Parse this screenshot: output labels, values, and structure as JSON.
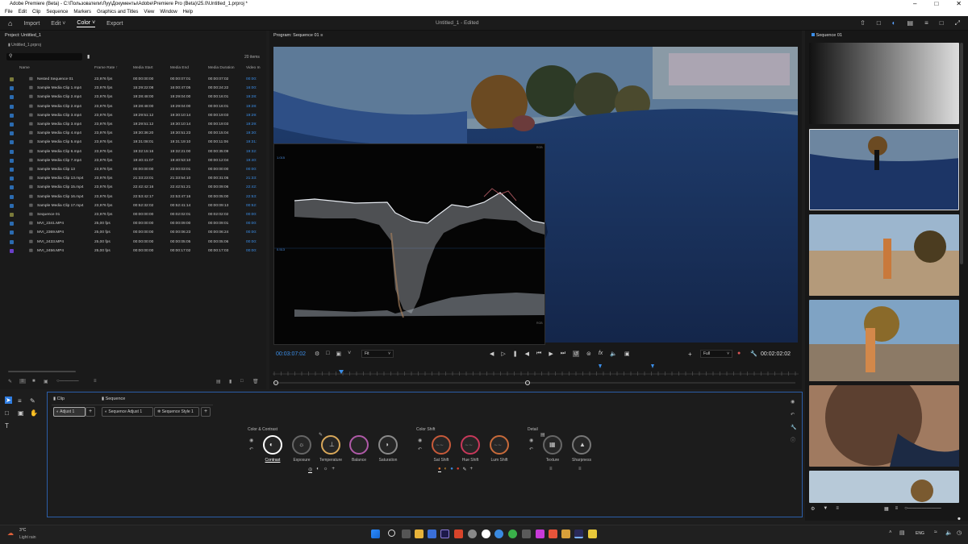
{
  "window": {
    "title": "Adobe Premiere (Beta) - C:\\Пользователи\\Луу\\Документы\\Adobe\\Premiere Pro (Beta)\\25.0\\Untitled_1.prproj *"
  },
  "menu": [
    "File",
    "Edit",
    "Clip",
    "Sequence",
    "Markers",
    "Graphics and Titles",
    "View",
    "Window",
    "Help"
  ],
  "header": {
    "nav": [
      "Import",
      "Edit",
      "Color",
      "Export"
    ],
    "active_nav": "Color",
    "document": "Untitled_1 - Edited"
  },
  "project": {
    "title": "Project: Untitled_1",
    "file": "Untitled_1.prproj",
    "items_count": "20 items",
    "columns": [
      "Name",
      "Frame Rate",
      "Media Start",
      "Media End",
      "Media Duration",
      "Video In"
    ],
    "rows": [
      {
        "name": "Nested Sequence 01",
        "fps": "23,976 fps",
        "start": "00:00:00:00",
        "end": "00:00:07:01",
        "dur": "00:00:07:02",
        "vin": "00:00:",
        "color": "#7a7a3a"
      },
      {
        "name": "Sample Media Clip 1.mp4",
        "fps": "23,976 fps",
        "start": "15:29:22:08",
        "end": "16:00:47:05",
        "dur": "00:00:24:22",
        "vin": "16:00:",
        "color": "#2b6bb0"
      },
      {
        "name": "Sample Media Clip 2.mp4",
        "fps": "23,976 fps",
        "start": "19:28:48:00",
        "end": "19:29:04:00",
        "dur": "00:00:16:01",
        "vin": "19:28:",
        "color": "#2b6bb0"
      },
      {
        "name": "Sample Media Clip 2.mp4",
        "fps": "23,976 fps",
        "start": "19:28:48:00",
        "end": "19:29:04:00",
        "dur": "00:00:16:01",
        "vin": "19:28:",
        "color": "#2b6bb0"
      },
      {
        "name": "Sample Media Clip 3.mp4",
        "fps": "23,976 fps",
        "start": "19:29:51:12",
        "end": "19:30:10:14",
        "dur": "00:00:19:03",
        "vin": "19:29:",
        "color": "#2b6bb0"
      },
      {
        "name": "Sample Media Clip 3.mp4",
        "fps": "23,976 fps",
        "start": "19:29:51:12",
        "end": "19:30:10:14",
        "dur": "00:00:19:03",
        "vin": "19:29:",
        "color": "#2b6bb0"
      },
      {
        "name": "Sample Media Clip 4.mp4",
        "fps": "23,976 fps",
        "start": "19:30:36:20",
        "end": "19:30:51:23",
        "dur": "00:00:15:04",
        "vin": "19:30:",
        "color": "#2b6bb0"
      },
      {
        "name": "Sample Media Clip 5.mp4",
        "fps": "23,976 fps",
        "start": "19:31:08:01",
        "end": "19:31:19:10",
        "dur": "00:00:11:06",
        "vin": "19:31:",
        "color": "#2b6bb0"
      },
      {
        "name": "Sample Media Clip 6.mp4",
        "fps": "23,976 fps",
        "start": "19:32:15:16",
        "end": "19:32:21:00",
        "dur": "00:00:35:09",
        "vin": "19:32:",
        "color": "#2b6bb0"
      },
      {
        "name": "Sample Media Clip 7.mp4",
        "fps": "23,976 fps",
        "start": "19:40:41:07",
        "end": "19:40:53:10",
        "dur": "00:00:12:04",
        "vin": "19:40:",
        "color": "#2b6bb0"
      },
      {
        "name": "Sample Media Clip 13",
        "fps": "23,976 fps",
        "start": "00:00:00:00",
        "end": "23:00:03:01",
        "dur": "00:00:00:00",
        "vin": "00:00:",
        "color": "#2b6bb0"
      },
      {
        "name": "Sample Media Clip 13.mp4",
        "fps": "23,976 fps",
        "start": "21:33:23:01",
        "end": "21:33:54:10",
        "dur": "00:00:31:05",
        "vin": "21:33:",
        "color": "#2b6bb0"
      },
      {
        "name": "Sample Media Clip 15.mp4",
        "fps": "23,976 fps",
        "start": "22:42:42:16",
        "end": "22:42:51:21",
        "dur": "00:00:09:06",
        "vin": "22:42:",
        "color": "#2b6bb0"
      },
      {
        "name": "Sample Media Clip 16.mp4",
        "fps": "23,976 fps",
        "start": "22:53:42:17",
        "end": "22:53:47:16",
        "dur": "00:00:05:00",
        "vin": "22:53:",
        "color": "#2b6bb0"
      },
      {
        "name": "Sample Media Clip 17.mp4",
        "fps": "23,976 fps",
        "start": "00:52:32:02",
        "end": "00:52:41:14",
        "dur": "00:00:09:13",
        "vin": "00:52:",
        "color": "#2b6bb0"
      },
      {
        "name": "Sequence 01",
        "fps": "23,976 fps",
        "start": "00:00:00:00",
        "end": "00:02:02:01",
        "dur": "00:02:02:02",
        "vin": "00:00:",
        "color": "#7a7a3a"
      },
      {
        "name": "MVI_2341.MP4",
        "fps": "25,00 fps",
        "start": "00:00:00:00",
        "end": "00:00:09:00",
        "dur": "00:00:09:01",
        "vin": "00:00:",
        "color": "#2b6bb0"
      },
      {
        "name": "MVI_2369.MP4",
        "fps": "25,00 fps",
        "start": "00:00:00:00",
        "end": "00:00:06:23",
        "dur": "00:00:06:24",
        "vin": "00:00:",
        "color": "#2b6bb0"
      },
      {
        "name": "MVI_2433.MP4",
        "fps": "25,00 fps",
        "start": "00:00:00:00",
        "end": "00:00:05:05",
        "dur": "00:00:05:06",
        "vin": "00:00:",
        "color": "#2b6bb0"
      },
      {
        "name": "MVI_2456.MP4",
        "fps": "25,00 fps",
        "start": "00:00:00:00",
        "end": "00:00:17:02",
        "dur": "00:00:17:03",
        "vin": "00:00:",
        "color": "#6a3fc8"
      }
    ]
  },
  "monitor": {
    "title": "Program: Sequence 01",
    "timecode_current": "00:03:07:02",
    "timecode_total": "00:02:02:02",
    "quality": "Full",
    "fit": "Fit",
    "scope_top": "1.015",
    "scope_mid": "0.513",
    "scope_top_right": "RGB",
    "scope_bottom_right": "RGB"
  },
  "sequence_panel": {
    "title": "Sequence 01"
  },
  "effects": {
    "tabs": [
      "Clip",
      "Sequence"
    ],
    "clip_chips": [
      "Adjust 1"
    ],
    "seq_chips": [
      "Sequence Adjust 1",
      "Sequence Style 1"
    ],
    "groups": [
      {
        "name": "Color & Contrast",
        "knobs": [
          "Contrast",
          "Exposure",
          "Temperature",
          "Balance",
          "Saturation"
        ]
      },
      {
        "name": "Color Shift",
        "knobs": [
          "Sat Shift",
          "Hue Shift",
          "Lum Shift"
        ]
      },
      {
        "name": "Detail",
        "knobs": [
          "Texture",
          "Sharpness"
        ]
      }
    ]
  },
  "taskbar": {
    "weather_temp": "3°C",
    "weather_desc": "Light rain",
    "lang": "ENG"
  },
  "colors": {
    "accent": "#2f7de1",
    "panel": "#191919",
    "timecode": "#3b8ee8"
  }
}
